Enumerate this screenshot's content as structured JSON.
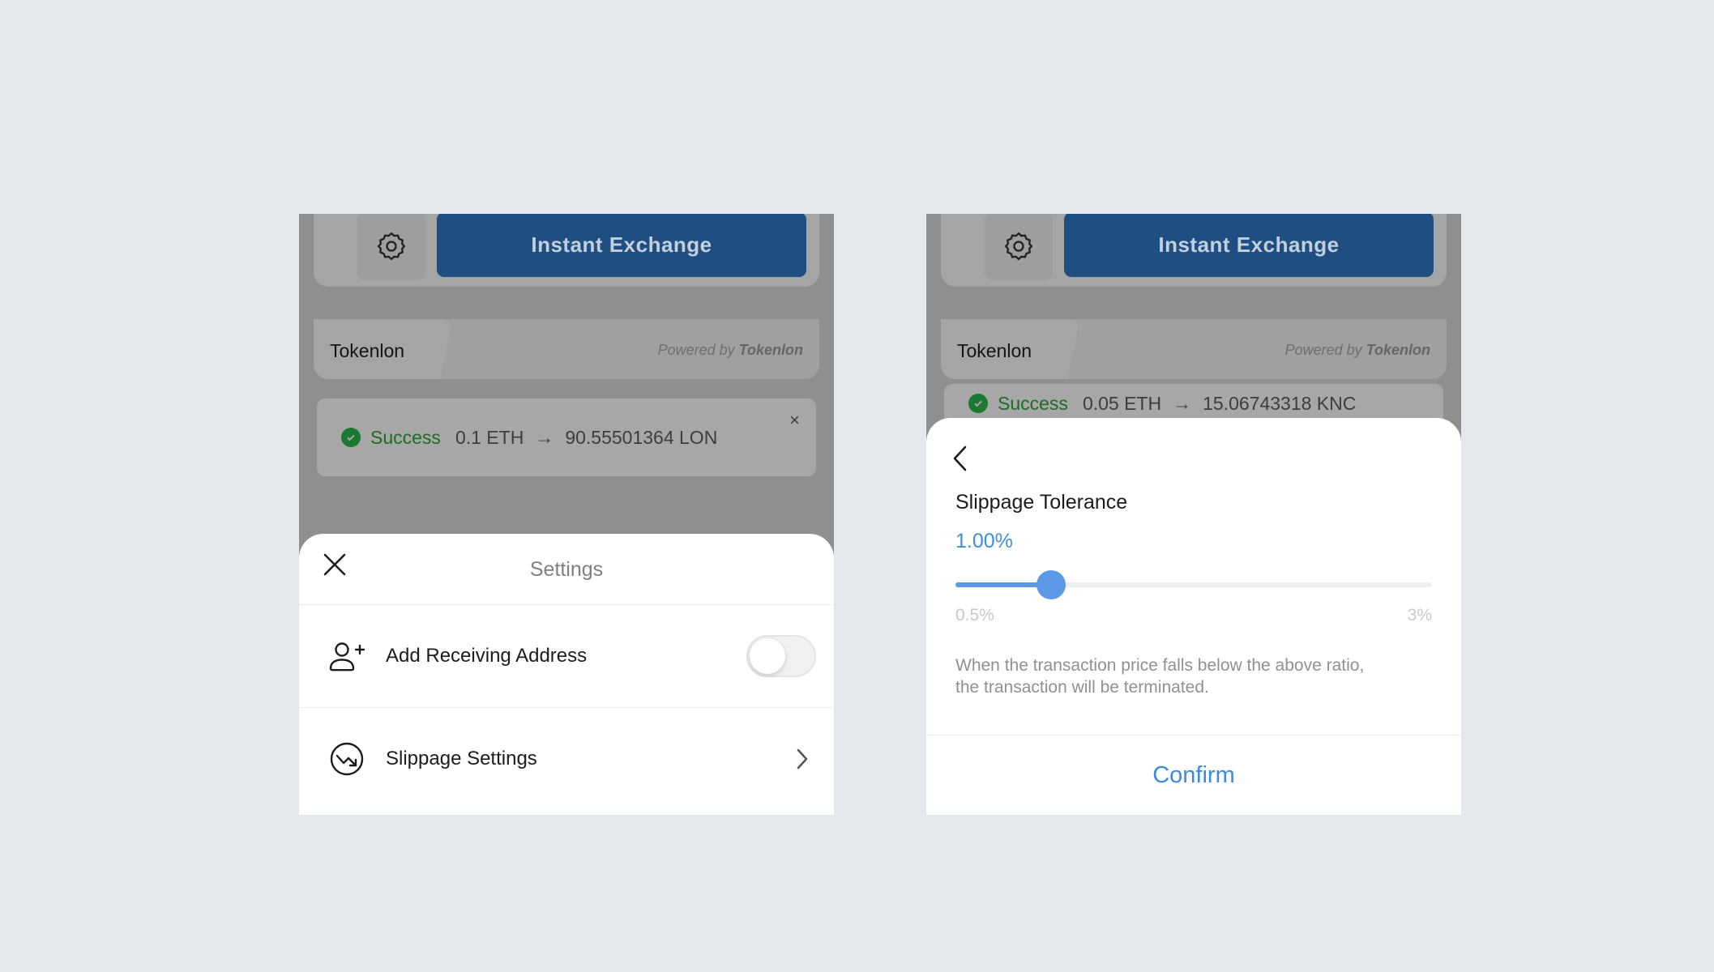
{
  "background_app": {
    "exchange_button_label": "Instant Exchange",
    "tab_label": "Tokenlon",
    "powered_prefix": "Powered by",
    "powered_brand": "Tokenlon"
  },
  "left_panel": {
    "notification": {
      "status": "Success",
      "from_amount": "0.1 ETH",
      "arrow": "→",
      "to_amount": "90.55501364 LON",
      "close_glyph": "×"
    },
    "settings_sheet": {
      "title": "Settings",
      "items": [
        {
          "label": "Add Receiving Address",
          "icon": "add-user-icon",
          "control": "toggle",
          "toggle_on": false
        },
        {
          "label": "Slippage Settings",
          "icon": "slippage-icon",
          "control": "chevron"
        }
      ]
    }
  },
  "right_panel": {
    "notification": {
      "status": "Success",
      "from_amount": "0.05 ETH",
      "arrow": "→",
      "to_amount": "15.06743318 KNC"
    },
    "slippage_sheet": {
      "title": "Slippage Tolerance",
      "value_label": "1.00%",
      "slider": {
        "min": 0.5,
        "max": 3,
        "value": 1.0
      },
      "min_label": "0.5%",
      "max_label": "3%",
      "note_line1": "When the transaction price falls below the above ratio,",
      "note_line2": "the transaction will be terminated.",
      "confirm_label": "Confirm"
    }
  },
  "colors": {
    "page_background": "#e3e8ec",
    "accent_blue": "#3d8ce8",
    "exchange_button": "#1f4f82",
    "success_green": "#1e6c24"
  }
}
